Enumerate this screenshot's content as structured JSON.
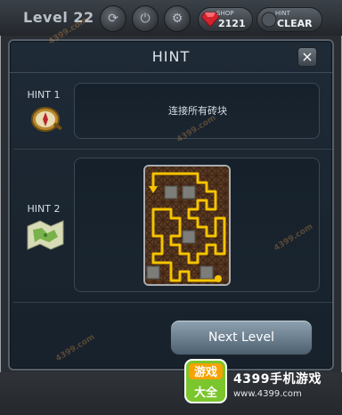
{
  "hud": {
    "level_label": "Level 22",
    "shop": {
      "label": "SHOP",
      "value": "2121"
    },
    "hint": {
      "label": "HINT",
      "value": "CLEAR"
    },
    "icons": [
      "refresh-icon",
      "power-icon",
      "settings-icon"
    ]
  },
  "modal": {
    "title": "HINT",
    "close_label": "×",
    "hint1": {
      "label": "HINT 1",
      "text": "连接所有砖块",
      "icon": "compass-icon"
    },
    "hint2": {
      "label": "HINT 2",
      "icon": "map-icon"
    },
    "next_button": "Next Level"
  },
  "watermarks": [
    "4399.com",
    "4399.com",
    "4399.com",
    "4399.com"
  ],
  "branding": {
    "logo_line1": "游戏",
    "logo_line2": "大全",
    "name": "4399手机游戏",
    "url": "www.4399.com"
  },
  "colors": {
    "accent_path": "#f5c400",
    "brick_dark": "#3a2416",
    "button_top": "#8fa2b2"
  }
}
